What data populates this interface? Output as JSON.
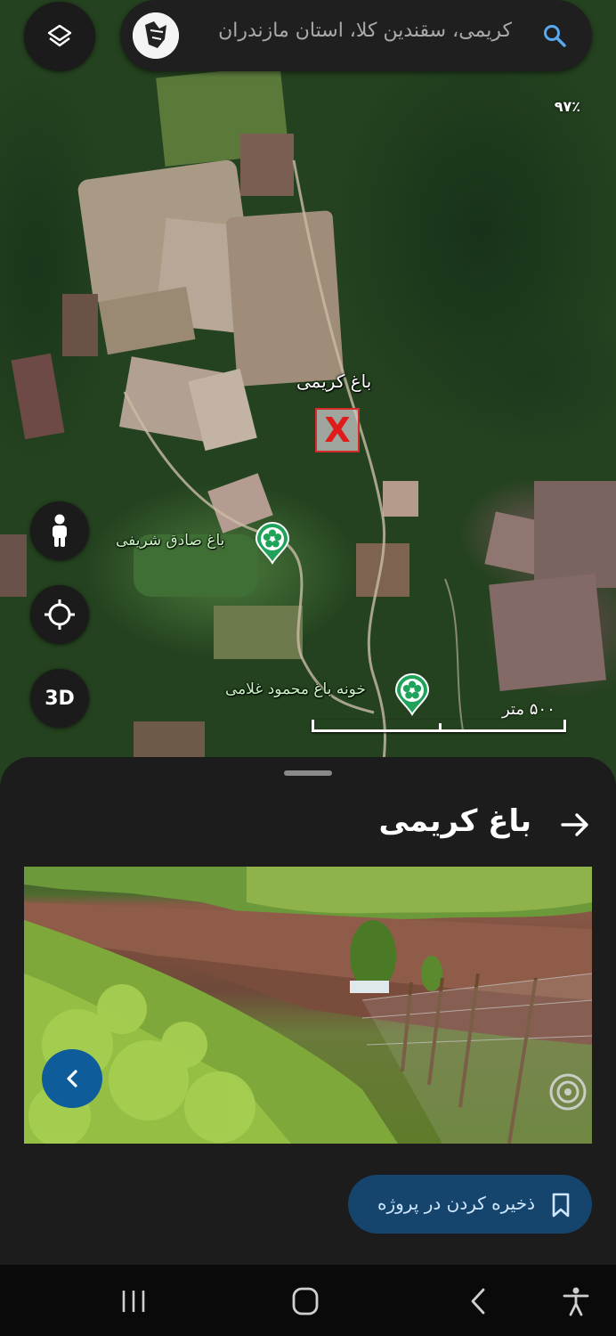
{
  "search": {
    "query": "کریمی، سقندین کلا، استان مازندران",
    "icon": "search-icon"
  },
  "map": {
    "zoom_text": "۹۷٪",
    "labels": {
      "main_place": "باغ کریمی",
      "poi_1": "باغ صادق شریفی",
      "poi_2": "خونه باغ محمود غلامی"
    },
    "marker_text": "X",
    "scale_text": "۵۰۰ متر",
    "buttons": {
      "layers": "layers-icon",
      "street_view": "pegman-icon",
      "locate": "crosshair-icon",
      "three_d": "3D"
    }
  },
  "sheet": {
    "title": "باغ کریمی",
    "save_label": "ذخیره کردن در پروژه"
  },
  "colors": {
    "sheet_bg": "#1c1c1c",
    "save_bg": "#15456d",
    "nav_prev_bg": "#0e5c9a",
    "pin_green": "#1fa35a",
    "marker_red": "#d42a2a"
  }
}
